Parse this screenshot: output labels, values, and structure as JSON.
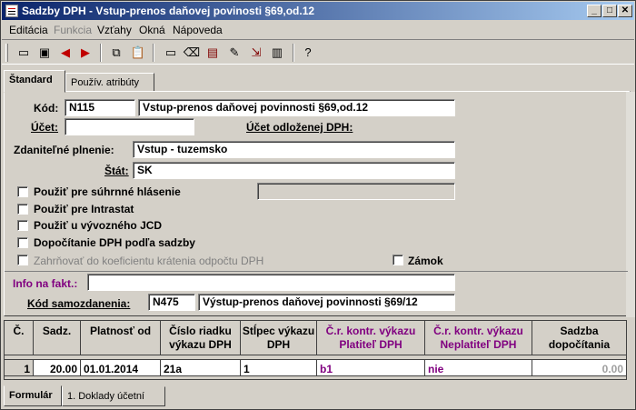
{
  "window": {
    "title": "Sadzby DPH - Vstup-prenos daňovej povinosti §69,od.12"
  },
  "menu": [
    "Editácia",
    "Funkcia",
    "Vzťahy",
    "Okná",
    "Nápoveda"
  ],
  "tabs": {
    "active": "Štandard",
    "inactive": "Použív. atribúty"
  },
  "form": {
    "kod_label": "Kód:",
    "kod_value": "N115",
    "kod_name": "Vstup-prenos daňovej povinnosti §69,od.12",
    "ucet_label": "Účet:",
    "ucet_value": "",
    "ucet_odl_label": "Účet odloženej DPH:",
    "zdan_label": "Zdaniteľné plnenie:",
    "zdan_value": "Vstup - tuzemsko",
    "stat_label": "Štát:",
    "stat_value": "SK",
    "chk1": "Použiť pre súhrnné hlásenie",
    "chk2": "Použiť pre Intrastat",
    "chk3": "Použiť u vývozného JCD",
    "chk4": "Dopočítanie DPH podľa sadzby",
    "chk5": "Zahrňovať do koeficientu krátenia odpočtu DPH",
    "zamok": "Zámok",
    "info_label": "Info na fakt.:",
    "info_value": "",
    "kod_samo_label": "Kód samozdanenia:",
    "kod_samo_value": "N475",
    "kod_samo_name": "Výstup-prenos daňovej povinnosti §69/12"
  },
  "table": {
    "headers": [
      "Č.",
      "Sadz.",
      "Platnosť od",
      "Číslo riadku výkazu DPH",
      "Stĺpec výkazu DPH",
      "Č.r. kontr. výkazu Platiteľ DPH",
      "Č.r. kontr. výkazu Neplatiteľ DPH",
      "Sadzba dopočítania"
    ],
    "rows": [
      [
        "1",
        "20.00",
        "01.01.2014",
        "21a",
        "1",
        "b1",
        "nie",
        "0.00"
      ]
    ]
  },
  "bottom_tabs": [
    "Formulár",
    "1. Doklady účetní"
  ],
  "colors": {
    "purple": "#800080",
    "title_start": "#0a246a",
    "title_end": "#a6caf0"
  }
}
